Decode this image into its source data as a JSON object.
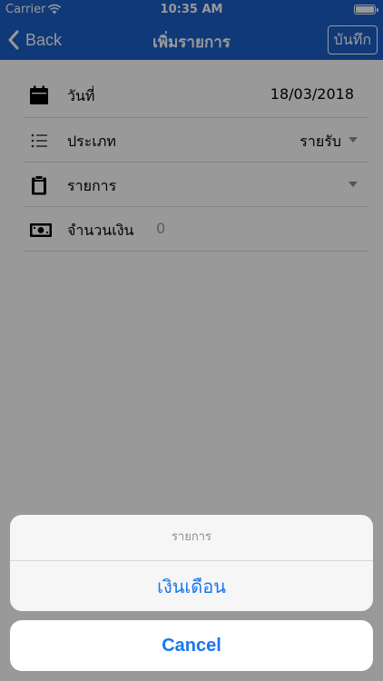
{
  "status_bar": {
    "carrier": "Carrier",
    "time": "10:35 AM"
  },
  "nav": {
    "back_label": "Back",
    "title": "เพิ่มรายการ",
    "save_label": "บันทึก"
  },
  "form": {
    "date": {
      "label": "วันที่",
      "value": "18/03/2018"
    },
    "type": {
      "label": "ประเภท",
      "value": "รายรับ"
    },
    "item": {
      "label": "รายการ",
      "value": ""
    },
    "amount": {
      "label": "จำนวนเงิน",
      "value": "0"
    }
  },
  "action_sheet": {
    "title": "รายการ",
    "options": [
      "เงินเดือน"
    ],
    "cancel_label": "Cancel"
  },
  "colors": {
    "nav_bar": "#1a5fc9",
    "action_tint": "#1777f0"
  }
}
